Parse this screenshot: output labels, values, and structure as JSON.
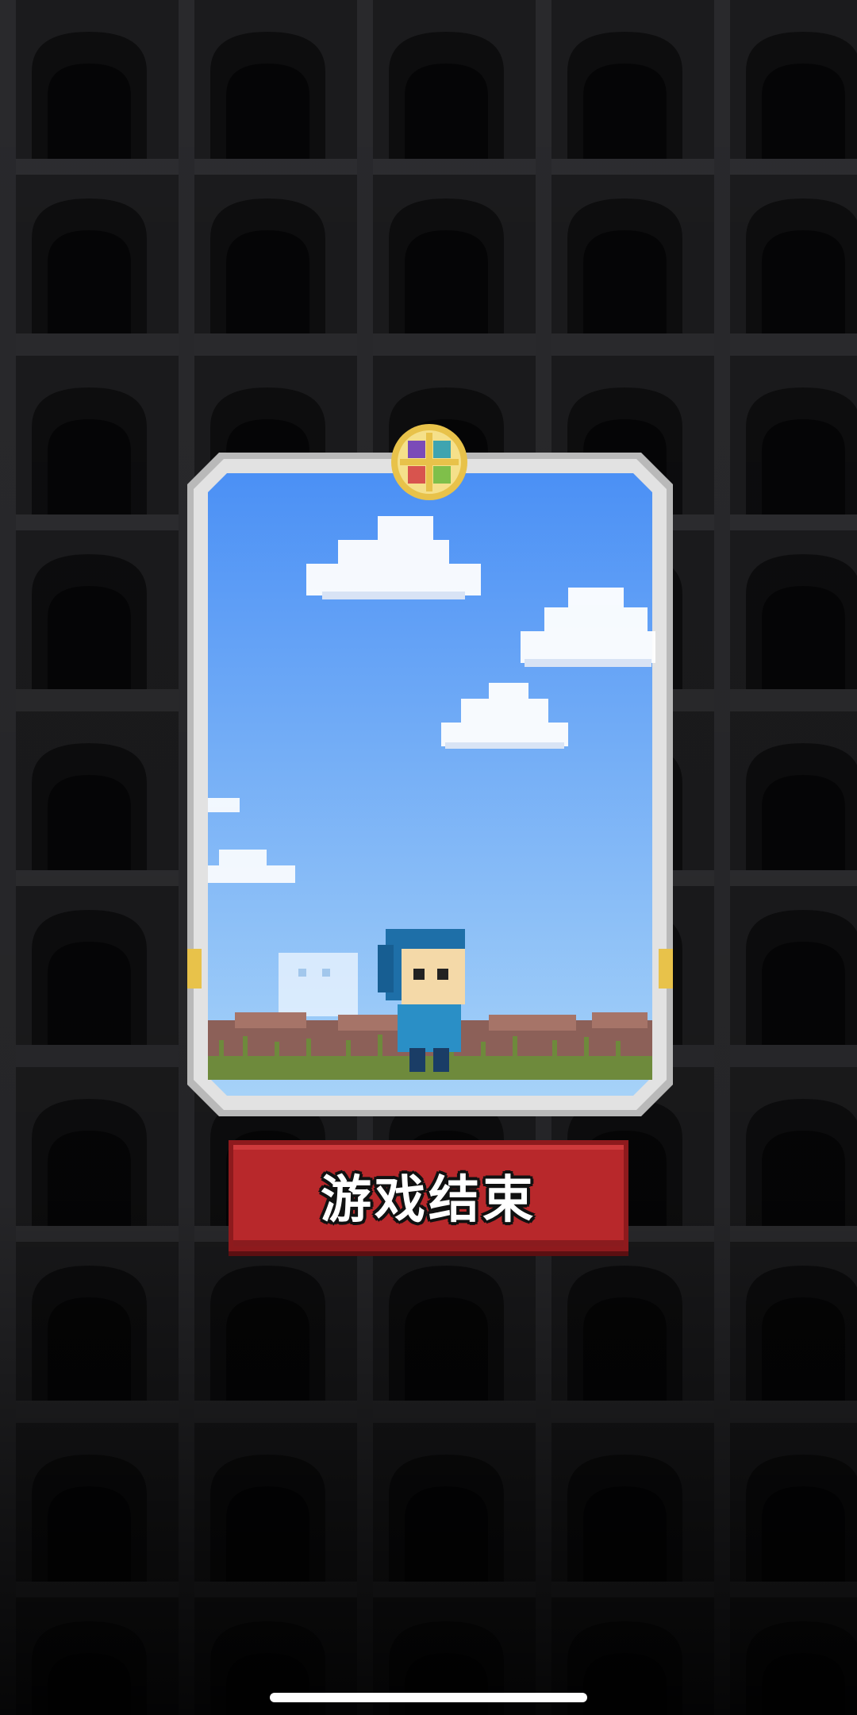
{
  "screen": {
    "title": "game-over-screen",
    "button": {
      "label": "游戏结束"
    }
  },
  "card": {
    "scene": "sky-and-grass",
    "character": "blue-hooded-hero",
    "badge_icon": "four-color-gem-icon"
  },
  "colors": {
    "button_red": "#b8282b",
    "sky_top": "#4b90f5",
    "sky_bottom": "#a6d2f8",
    "frame": "#d9d9d9",
    "badge_gold": "#e8c24a"
  }
}
